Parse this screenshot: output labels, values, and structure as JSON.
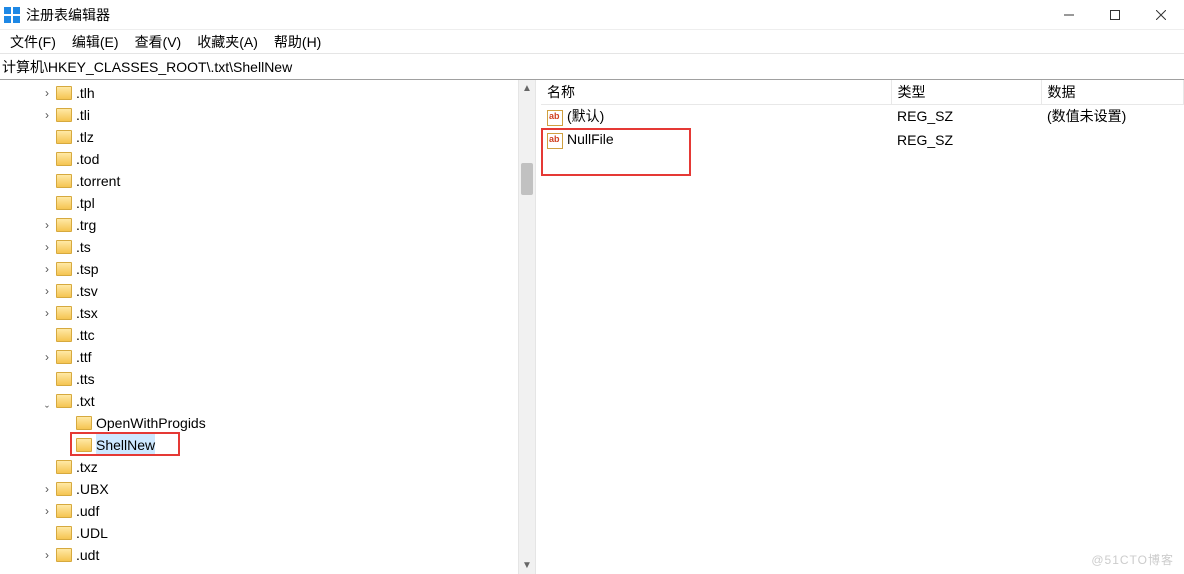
{
  "window": {
    "title": "注册表编辑器"
  },
  "menu": {
    "file": "文件(F)",
    "edit": "编辑(E)",
    "view": "查看(V)",
    "fav": "收藏夹(A)",
    "help": "帮助(H)"
  },
  "address": "计算机\\HKEY_CLASSES_ROOT\\.txt\\ShellNew",
  "tree": {
    "root_label": "计算机",
    "keys": [
      {
        "name": ".tlh",
        "expandable": true,
        "indent": 0
      },
      {
        "name": ".tli",
        "expandable": true,
        "indent": 0
      },
      {
        "name": ".tlz",
        "expandable": false,
        "indent": 0
      },
      {
        "name": ".tod",
        "expandable": false,
        "indent": 0
      },
      {
        "name": ".torrent",
        "expandable": false,
        "indent": 0
      },
      {
        "name": ".tpl",
        "expandable": false,
        "indent": 0
      },
      {
        "name": ".trg",
        "expandable": true,
        "indent": 0
      },
      {
        "name": ".ts",
        "expandable": true,
        "indent": 0
      },
      {
        "name": ".tsp",
        "expandable": true,
        "indent": 0
      },
      {
        "name": ".tsv",
        "expandable": true,
        "indent": 0
      },
      {
        "name": ".tsx",
        "expandable": true,
        "indent": 0
      },
      {
        "name": ".ttc",
        "expandable": false,
        "indent": 0
      },
      {
        "name": ".ttf",
        "expandable": true,
        "indent": 0
      },
      {
        "name": ".tts",
        "expandable": false,
        "indent": 0
      },
      {
        "name": ".txt",
        "expandable": true,
        "indent": 0,
        "expanded": true
      },
      {
        "name": "OpenWithProgids",
        "expandable": false,
        "indent": 1
      },
      {
        "name": "ShellNew",
        "expandable": false,
        "indent": 1,
        "selected": true,
        "highlight": true
      },
      {
        "name": ".txz",
        "expandable": false,
        "indent": 0
      },
      {
        "name": ".UBX",
        "expandable": true,
        "indent": 0
      },
      {
        "name": ".udf",
        "expandable": true,
        "indent": 0
      },
      {
        "name": ".UDL",
        "expandable": false,
        "indent": 0
      },
      {
        "name": ".udt",
        "expandable": true,
        "indent": 0
      }
    ]
  },
  "list": {
    "columns": {
      "name": "名称",
      "type": "类型",
      "data": "数据"
    },
    "rows": [
      {
        "name": "(默认)",
        "type": "REG_SZ",
        "data": "(数值未设置)"
      },
      {
        "name": "NullFile",
        "type": "REG_SZ",
        "data": "",
        "highlight": true
      }
    ]
  },
  "watermark": "@51CTO博客"
}
